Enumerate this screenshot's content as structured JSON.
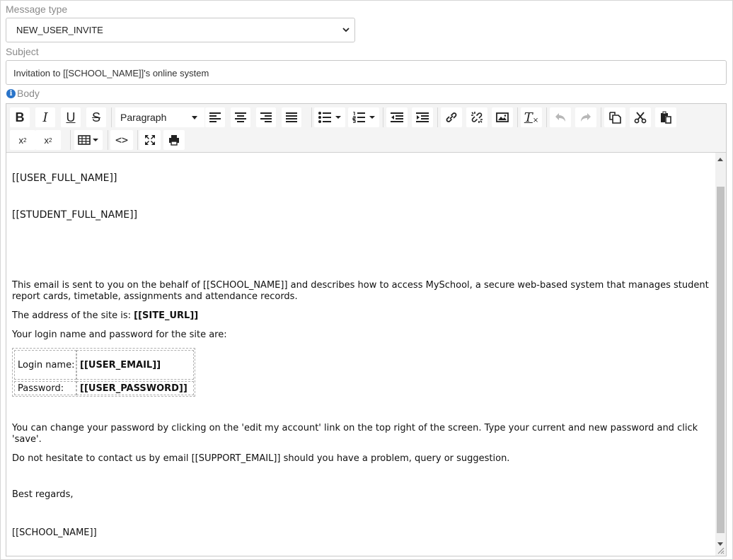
{
  "form": {
    "message_type_label": "Message type",
    "message_type_value": "NEW_USER_INVITE",
    "subject_label": "Subject",
    "subject_value": "Invitation to [[SCHOOL_NAME]]'s online system",
    "body_label": "Body",
    "info_glyph": "i"
  },
  "toolbar": {
    "bold": "B",
    "italic": "I",
    "underline": "U",
    "strikethrough": "S",
    "block_format": "Paragraph",
    "clear_format": "T",
    "superscript": "x",
    "superscript_mark": "2",
    "subscript": "x",
    "subscript_mark": "2",
    "source_code": "<>"
  },
  "body": {
    "line_user": "[[USER_FULL_NAME]]",
    "line_student": "[[STUDENT_FULL_NAME]]",
    "intro": "This email is sent to you on the behalf of [[SCHOOL_NAME]] and describes how to access MySchool, a secure web-based system that manages student report cards, timetable, assignments and attendance records.",
    "address_prefix": "The address of the site is: ",
    "address_value": "[[SITE_URL]]",
    "login_intro": "Your login name and password for the site are:",
    "table": {
      "login_label": "Login name:",
      "login_value": "[[USER_EMAIL]]",
      "password_label": "Password:",
      "password_value": "[[USER_PASSWORD]]"
    },
    "change_password": "You can change your password by clicking on the 'edit my account' link on the top right of the screen. Type your current and new password and click 'save'.",
    "contact": "Do not hesitate to contact us by email [[SUPPORT_EMAIL]] should you have a problem, query or suggestion.",
    "regards": "Best regards,",
    "signature": "[[SCHOOL_NAME]]"
  },
  "colors": {
    "label": "#8a8a8a",
    "info_icon": "#2a74c9",
    "toolbar_bg": "#f4f4f4",
    "disabled": "#b7b7b7"
  },
  "icons": [
    "chevron-down-icon",
    "info-icon",
    "align-left-icon",
    "align-center-icon",
    "align-right-icon",
    "align-justify-icon",
    "bullet-list-icon",
    "numbered-list-icon",
    "outdent-icon",
    "indent-icon",
    "link-icon",
    "unlink-icon",
    "image-icon",
    "undo-icon",
    "redo-icon",
    "copy-icon",
    "cut-icon",
    "paste-icon",
    "table-icon",
    "fullscreen-icon",
    "print-icon",
    "resize-grip-icon"
  ]
}
